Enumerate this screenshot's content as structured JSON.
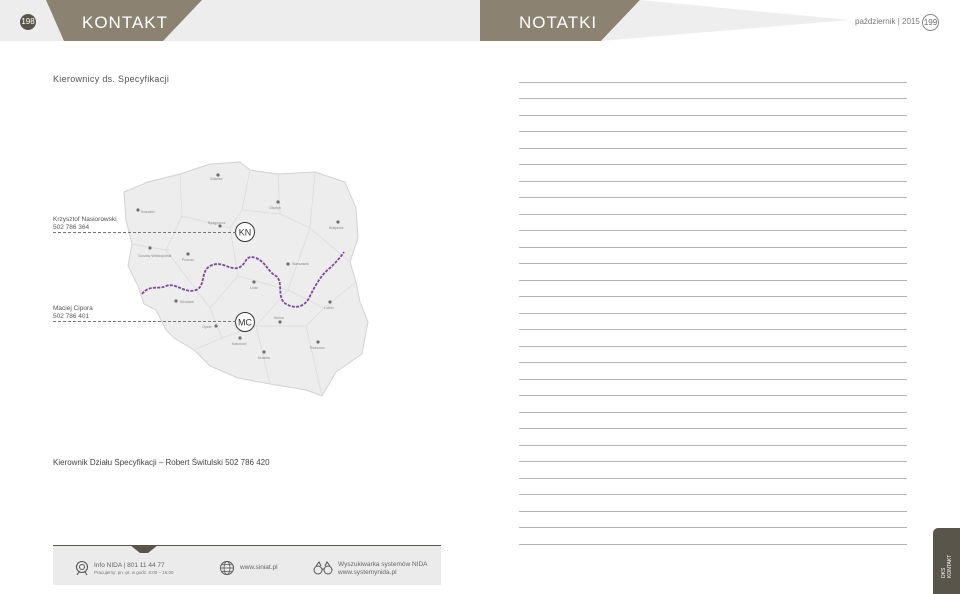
{
  "header": {
    "left_page_number": "198",
    "left_title": "KONTAKT",
    "right_title": "NOTATKI",
    "date": "październik | 2015",
    "right_page_number": "199"
  },
  "section_heading": "Kierownicy ds. Specyfikacji",
  "managers": [
    {
      "name": "Krzysztof Nasiorowski",
      "phone": "502 786 364",
      "initials": "KN"
    },
    {
      "name": "Maciej Cipora",
      "phone": "502 786 401",
      "initials": "MC"
    }
  ],
  "map_cities": [
    "Gdańsk",
    "Koszalin",
    "Olsztyn",
    "Bydgoszcz",
    "Białystok",
    "Gorzów Wielkopolski",
    "Poznań",
    "Warszawa",
    "Łódź",
    "Wrocław",
    "Lublin",
    "Opole",
    "Kielce",
    "Katowice",
    "Rzeszów",
    "Kraków"
  ],
  "department_head": "Kierownik Działu Specyfikacji – Robert Świtulski 502 786 420",
  "footer": {
    "info_line": "Info NIDA | 801 11 44 77",
    "hours_line": "Pracujemy: pn.-pt. w godz. 8:00 – 16:00",
    "website": "www.siniat.pl",
    "search_label": "Wyszukiwarka systemów NIDA",
    "search_url": "www.systemynida.pl"
  },
  "side_tab": {
    "line1": "DKS",
    "line2": "KONTAKT"
  },
  "colors": {
    "accent": "#5a554a",
    "boundary": "#7b4a9c",
    "header_gray": "#ededed"
  }
}
